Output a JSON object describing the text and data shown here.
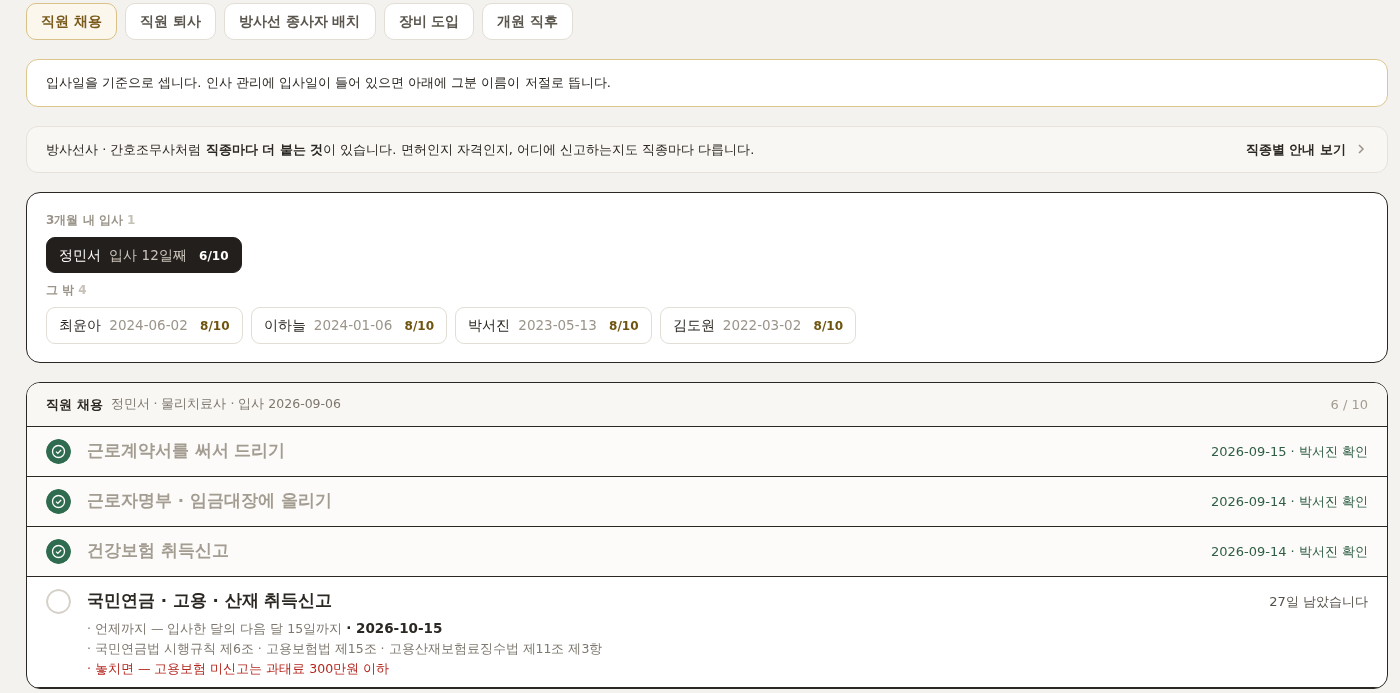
{
  "tabs": [
    {
      "label": "직원 채용",
      "selected": true
    },
    {
      "label": "직원 퇴사",
      "selected": false
    },
    {
      "label": "방사선 종사자 배치",
      "selected": false
    },
    {
      "label": "장비 도입",
      "selected": false
    },
    {
      "label": "개원 직후",
      "selected": false
    }
  ],
  "intro_note": "입사일을 기준으로 셉니다. 인사 관리에 입사일이 들어 있으면 아래에 그분 이름이 저절로 뜹니다.",
  "notice": {
    "text": "방사선사 · 간호조무사처럼 **직종마다 더 붙는 것**이 있습니다. 면허인지 자격인지, 어디에 신고하는지도 직종마다 다릅니다.",
    "link": "직종별 안내 보기"
  },
  "staff_groups": [
    {
      "label": "3개월 내 입사",
      "count": "1",
      "members": [
        {
          "name": "정민서",
          "detail": "입사 12일째",
          "score": "6/10",
          "selected": true
        }
      ]
    },
    {
      "label": "그 밖",
      "count": "4",
      "members": [
        {
          "name": "최윤아",
          "detail": "2024-06-02",
          "score": "8/10",
          "selected": false
        },
        {
          "name": "이하늘",
          "detail": "2024-01-06",
          "score": "8/10",
          "selected": false
        },
        {
          "name": "박서진",
          "detail": "2023-05-13",
          "score": "8/10",
          "selected": false
        },
        {
          "name": "김도원",
          "detail": "2022-03-02",
          "score": "8/10",
          "selected": false
        }
      ]
    }
  ],
  "checklist": {
    "title": "직원 채용",
    "subtitle": "정민서 · 물리치료사 · 입사 2026-09-06",
    "progress": "6 / 10",
    "items": [
      {
        "title": "근로계약서를 써서 드리기",
        "done": true,
        "status": "2026-09-15 · 박서진 확인"
      },
      {
        "title": "근로자명부 · 임금대장에 올리기",
        "done": true,
        "status": "2026-09-14 · 박서진 확인"
      },
      {
        "title": "건강보험 취득신고",
        "done": true,
        "status": "2026-09-14 · 박서진 확인"
      },
      {
        "title": "국민연금 · 고용 · 산재 취득신고",
        "done": false,
        "status": "27일 남았습니다",
        "details": [
          {
            "kind": "due",
            "text": "· 언제까지 — 입사한 달의 다음 달 15일까지 **· 2026-10-15**"
          },
          {
            "kind": "law",
            "text": "· 국민연금법 시행규칙 제6조 · 고용보험법 제15조 · 고용산재보험료징수법 제11조 제3항"
          },
          {
            "kind": "penalty",
            "text": "· 놓치면 — 고용보험 미신고는 과태료 300만원 이하"
          }
        ]
      }
    ]
  }
}
